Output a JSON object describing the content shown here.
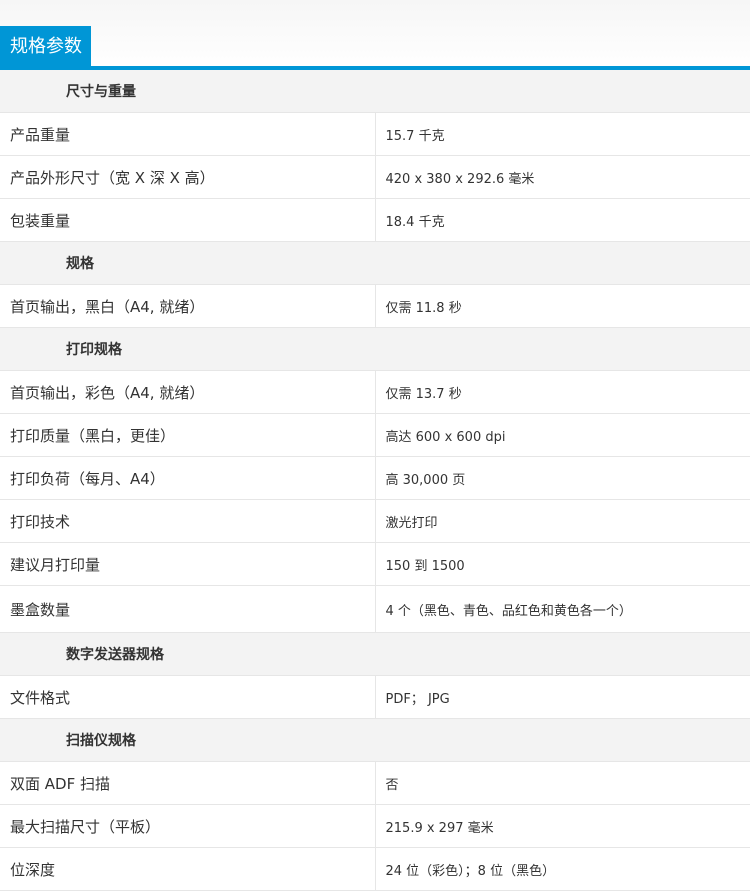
{
  "header": {
    "title": "规格参数"
  },
  "sections": {
    "size_weight": {
      "title": "尺寸与重量",
      "rows": [
        {
          "label": "产品重量",
          "value": "15.7 千克"
        },
        {
          "label": "产品外形尺寸（宽 X 深 X 高）",
          "value": "420 x 380 x 292.6 毫米"
        },
        {
          "label": "包装重量",
          "value": "18.4 千克"
        }
      ]
    },
    "specs": {
      "title": "规格",
      "rows": [
        {
          "label": "首页输出，黑白（A4, 就绪）",
          "value": "仅需 11.8 秒"
        }
      ]
    },
    "print_specs": {
      "title": "打印规格",
      "rows": [
        {
          "label": "首页输出，彩色（A4, 就绪）",
          "value": "仅需 13.7 秒"
        },
        {
          "label": "打印质量（黑白，更佳）",
          "value": "高达 600 x 600 dpi"
        },
        {
          "label": "打印负荷（每月、A4）",
          "value": "高 30,000 页"
        },
        {
          "label": "打印技术",
          "value": "激光打印"
        },
        {
          "label": "建议月打印量",
          "value": "150 到 1500"
        },
        {
          "label": "墨盒数量",
          "value": "4 个（黑色、青色、品红色和黄色各一个）"
        }
      ]
    },
    "digital_send": {
      "title": "数字发送器规格",
      "rows": [
        {
          "label": "文件格式",
          "value": "PDF； JPG"
        }
      ]
    },
    "scanner": {
      "title": "扫描仪规格",
      "rows": [
        {
          "label": "双面 ADF 扫描",
          "value": "否"
        },
        {
          "label": "最大扫描尺寸（平板）",
          "value": "215.9 x 297 毫米"
        },
        {
          "label": "位深度",
          "value": "24 位（彩色）；8 位（黑色）"
        }
      ]
    }
  }
}
